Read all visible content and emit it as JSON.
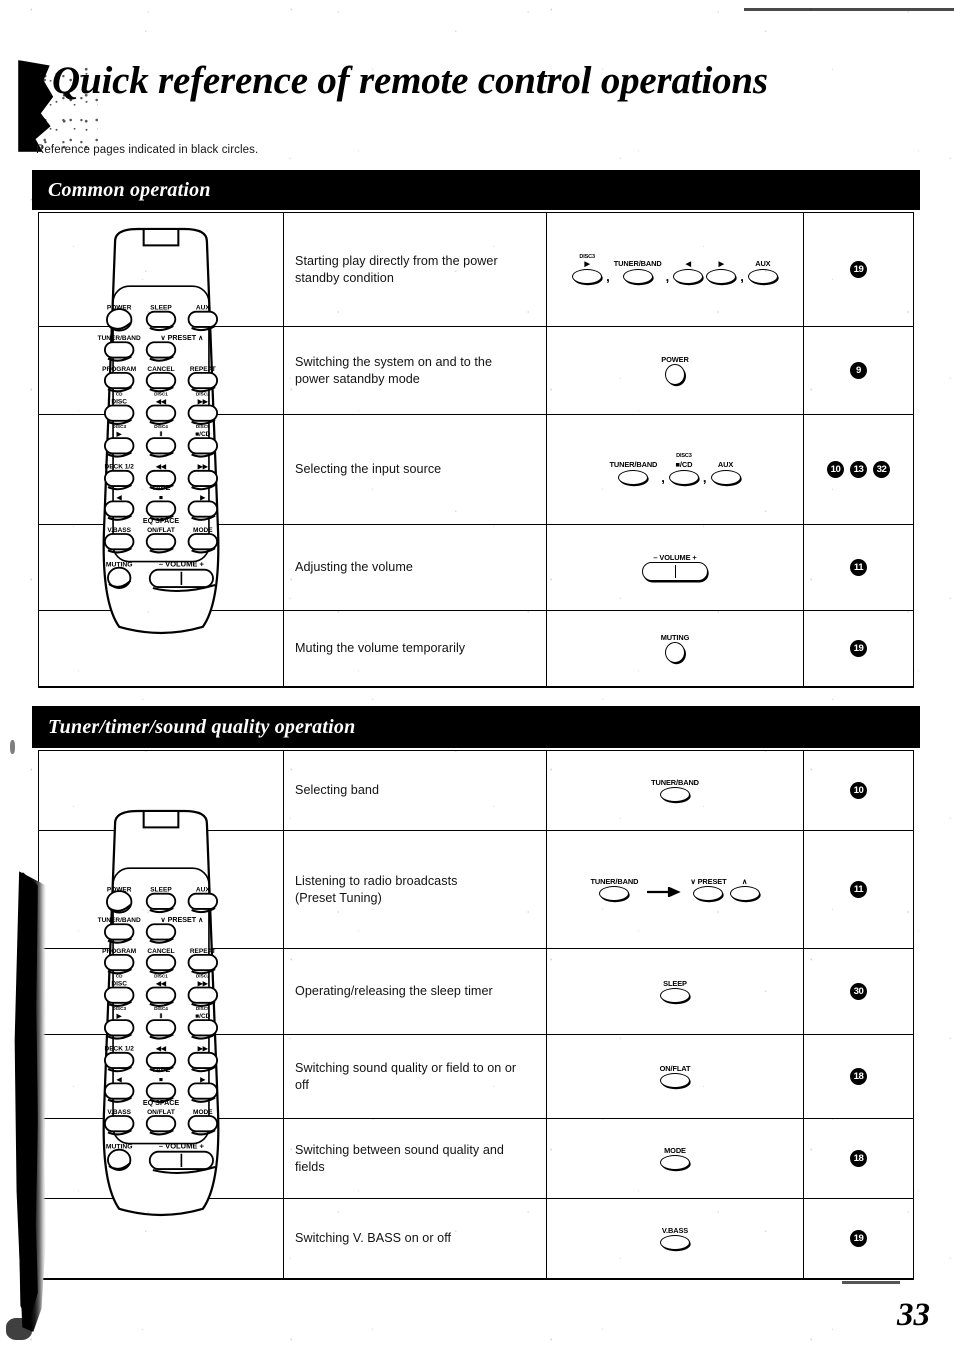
{
  "page": {
    "title": "Quick reference of remote control operations",
    "note": "Reference pages indicated in black circles.",
    "folio": "33"
  },
  "sections": [
    {
      "id": "common",
      "heading": "Common operation",
      "rows": [
        {
          "description": "Starting play directly from the power\nstandby condition",
          "buttons": [
            {
              "type": "oval",
              "cap_top": "DISC3",
              "cap_sym": "▶"
            },
            {
              "type": "comma",
              "text": ","
            },
            {
              "type": "oval",
              "cap": "TUNER/BAND"
            },
            {
              "type": "comma",
              "text": ","
            },
            {
              "type": "oval",
              "cap_sym": "◀"
            },
            {
              "type": "oval",
              "cap_sym": "▶"
            },
            {
              "type": "comma",
              "text": ","
            },
            {
              "type": "oval",
              "cap": "AUX"
            }
          ],
          "page_refs": [
            "19"
          ]
        },
        {
          "description": "Switching the system on and to the\npower satandby mode",
          "buttons": [
            {
              "type": "circle",
              "cap": "POWER"
            }
          ],
          "page_refs": [
            "9"
          ]
        },
        {
          "description": "Selecting the input source",
          "buttons": [
            {
              "type": "oval",
              "cap": "TUNER/BAND"
            },
            {
              "type": "comma",
              "text": ","
            },
            {
              "type": "oval",
              "cap_top": "DISC3",
              "cap": "■/CD"
            },
            {
              "type": "comma",
              "text": ","
            },
            {
              "type": "oval",
              "cap": "AUX"
            }
          ],
          "page_refs": [
            "10",
            "13",
            "32"
          ]
        },
        {
          "description": "Adjusting the volume",
          "buttons": [
            {
              "type": "volume",
              "cap": "– VOLUME +"
            }
          ],
          "page_refs": [
            "11"
          ]
        },
        {
          "description": "Muting the volume temporarily",
          "buttons": [
            {
              "type": "circle",
              "cap": "MUTING"
            }
          ],
          "page_refs": [
            "19"
          ]
        }
      ]
    },
    {
      "id": "tuner",
      "heading": "Tuner/timer/sound quality operation",
      "rows": [
        {
          "description": "Selecting band",
          "buttons": [
            {
              "type": "oval",
              "cap": "TUNER/BAND"
            }
          ],
          "page_refs": [
            "10"
          ]
        },
        {
          "description": "Listening to radio broadcasts\n(Preset Tuning)",
          "buttons": [
            {
              "type": "oval",
              "cap": "TUNER/BAND"
            },
            {
              "type": "arrow",
              "text": "→"
            },
            {
              "type": "oval",
              "cap": "∨ PRESET"
            },
            {
              "type": "oval",
              "cap": "∧"
            }
          ],
          "page_refs": [
            "11"
          ]
        },
        {
          "description": "Operating/releasing the sleep timer",
          "buttons": [
            {
              "type": "oval",
              "cap": "SLEEP"
            }
          ],
          "page_refs": [
            "30"
          ]
        },
        {
          "description": "Switching sound quality or field to on or\noff",
          "buttons": [
            {
              "type": "oval",
              "cap": "ON/FLAT"
            }
          ],
          "page_refs": [
            "18"
          ]
        },
        {
          "description": "Switching between sound quality and\nfields",
          "buttons": [
            {
              "type": "oval",
              "cap": "MODE"
            }
          ],
          "page_refs": [
            "18"
          ]
        },
        {
          "description": "Switching V. BASS on or off",
          "buttons": [
            {
              "type": "oval",
              "cap": "V.BASS"
            }
          ],
          "page_refs": [
            "19"
          ]
        }
      ]
    }
  ],
  "remote": {
    "name": "remote-control-unit",
    "button_rows": [
      {
        "labels": [
          "POWER",
          "SLEEP",
          "AUX"
        ]
      },
      {
        "labels": [
          "TUNER/BAND",
          "∨ PRESET ∧",
          ""
        ]
      },
      {
        "labels": [
          "PROGRAM",
          "CANCEL",
          "REPEAT"
        ]
      },
      {
        "labels": [
          "DISC",
          "◀◀",
          "▶▶"
        ],
        "sub": [
          "CD",
          "DISC1",
          "DISC2"
        ]
      },
      {
        "labels": [
          "▶",
          "Ⅱ",
          "■/CD"
        ],
        "sub": [
          "DISC3",
          "DISC4",
          "DISC5"
        ]
      },
      {
        "labels": [
          "DECK 1/2",
          "◀◀",
          "▶▶"
        ]
      },
      {
        "labels": [
          "◀",
          "■",
          "▶"
        ],
        "group": "TAPE"
      },
      {
        "labels": [
          "V.BASS",
          "ON/FLAT",
          "MODE"
        ],
        "group": "EQ  SPACE"
      },
      {
        "labels": [
          "MUTING",
          "– VOLUME +"
        ]
      }
    ]
  }
}
